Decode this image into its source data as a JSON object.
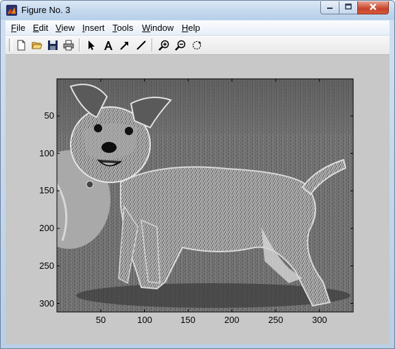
{
  "window": {
    "title": "Figure No. 3",
    "icon": "matlab-icon",
    "controls": [
      "minimize-icon",
      "maximize-icon",
      "close-icon"
    ]
  },
  "menu": [
    {
      "label": "File",
      "mnemonic": "F"
    },
    {
      "label": "Edit",
      "mnemonic": "E"
    },
    {
      "label": "View",
      "mnemonic": "V"
    },
    {
      "label": "Insert",
      "mnemonic": "I"
    },
    {
      "label": "Tools",
      "mnemonic": "T"
    },
    {
      "label": "Window",
      "mnemonic": "W"
    },
    {
      "label": "Help",
      "mnemonic": "H"
    }
  ],
  "toolbar": [
    "new-figure-icon",
    "open-folder-icon",
    "save-icon",
    "print-icon",
    "select-arrow-icon",
    "insert-text-icon",
    "insert-arrow-icon",
    "insert-line-icon",
    "zoom-in-icon",
    "zoom-out-icon",
    "rotate-3d-icon"
  ],
  "axes": {
    "y_ticks": [
      "50",
      "100",
      "150",
      "200",
      "250",
      "300"
    ],
    "x_ticks": [
      "50",
      "100",
      "150",
      "200",
      "250",
      "300"
    ],
    "image": "grayscale photo of a terrier dog standing on grass beside a ball"
  },
  "colors": {
    "figure_background": "#c8c8c8",
    "titlebar": "#c6d9ee",
    "close_button": "#c7432a"
  }
}
